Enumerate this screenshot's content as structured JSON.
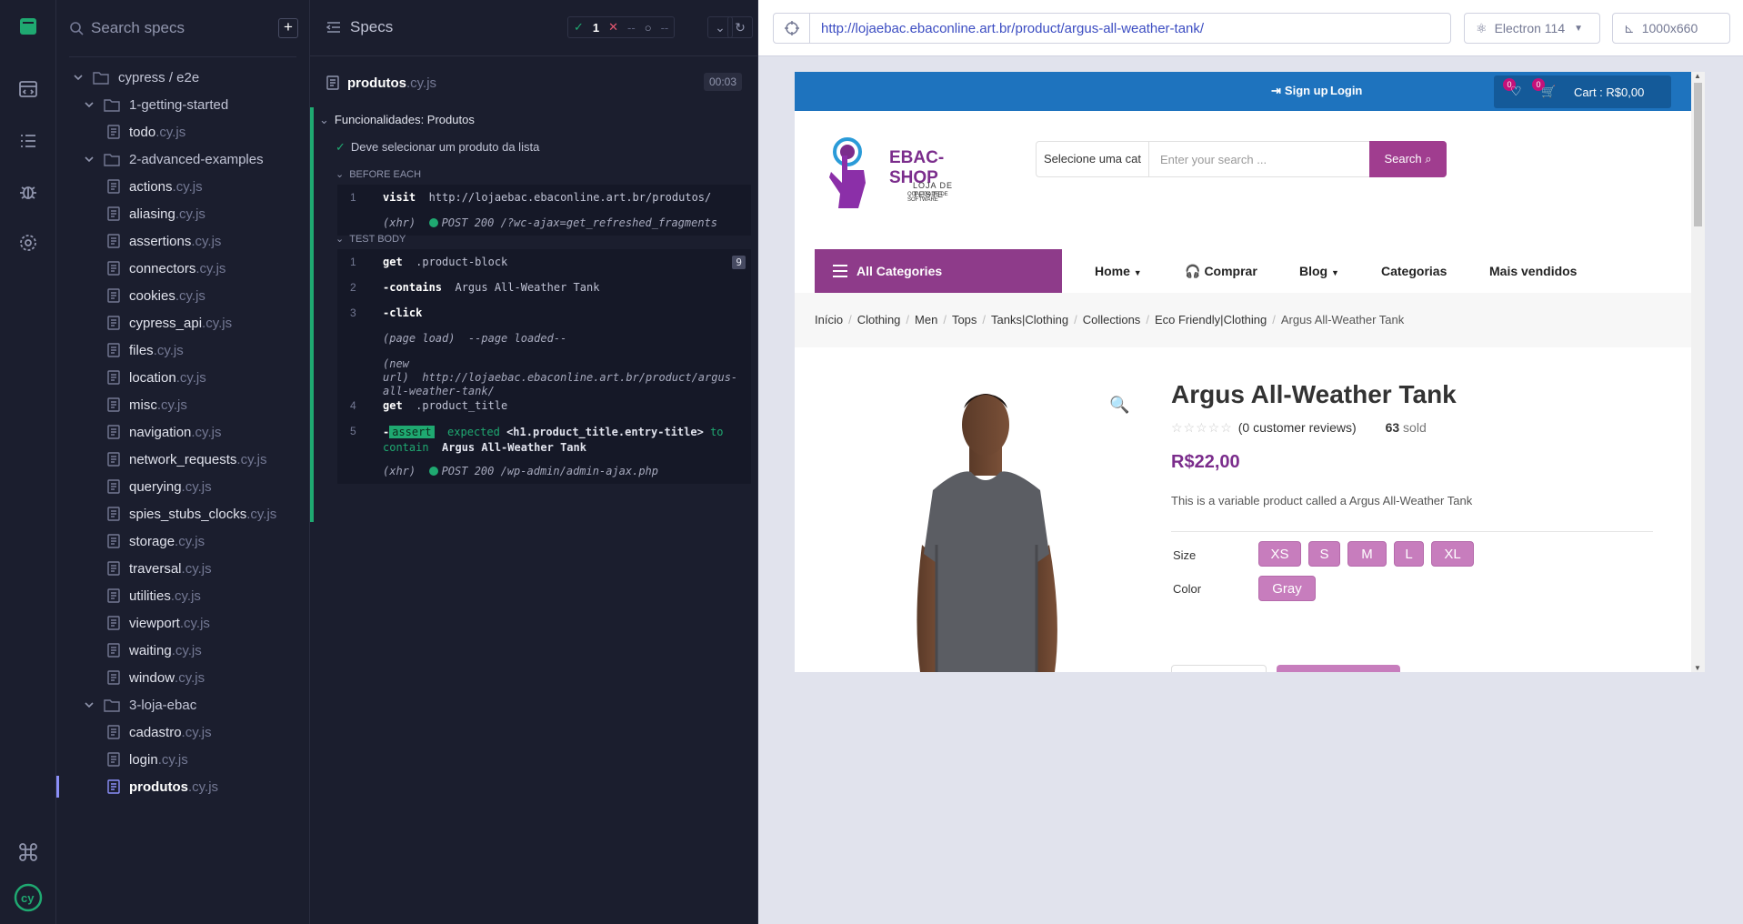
{
  "sidebar": {
    "search_placeholder": "Search specs",
    "add_label": "+",
    "tree": [
      {
        "type": "dir",
        "label": "cypress / e2e",
        "depth": 0
      },
      {
        "type": "dir",
        "label": "1-getting-started",
        "depth": 1
      },
      {
        "type": "file",
        "name": "todo",
        "ext": ".cy.js",
        "depth": 2
      },
      {
        "type": "dir",
        "label": "2-advanced-examples",
        "depth": 1
      },
      {
        "type": "file",
        "name": "actions",
        "ext": ".cy.js",
        "depth": 2
      },
      {
        "type": "file",
        "name": "aliasing",
        "ext": ".cy.js",
        "depth": 2
      },
      {
        "type": "file",
        "name": "assertions",
        "ext": ".cy.js",
        "depth": 2
      },
      {
        "type": "file",
        "name": "connectors",
        "ext": ".cy.js",
        "depth": 2
      },
      {
        "type": "file",
        "name": "cookies",
        "ext": ".cy.js",
        "depth": 2
      },
      {
        "type": "file",
        "name": "cypress_api",
        "ext": ".cy.js",
        "depth": 2
      },
      {
        "type": "file",
        "name": "files",
        "ext": ".cy.js",
        "depth": 2
      },
      {
        "type": "file",
        "name": "location",
        "ext": ".cy.js",
        "depth": 2
      },
      {
        "type": "file",
        "name": "misc",
        "ext": ".cy.js",
        "depth": 2
      },
      {
        "type": "file",
        "name": "navigation",
        "ext": ".cy.js",
        "depth": 2
      },
      {
        "type": "file",
        "name": "network_requests",
        "ext": ".cy.js",
        "depth": 2
      },
      {
        "type": "file",
        "name": "querying",
        "ext": ".cy.js",
        "depth": 2
      },
      {
        "type": "file",
        "name": "spies_stubs_clocks",
        "ext": ".cy.js",
        "depth": 2
      },
      {
        "type": "file",
        "name": "storage",
        "ext": ".cy.js",
        "depth": 2
      },
      {
        "type": "file",
        "name": "traversal",
        "ext": ".cy.js",
        "depth": 2
      },
      {
        "type": "file",
        "name": "utilities",
        "ext": ".cy.js",
        "depth": 2
      },
      {
        "type": "file",
        "name": "viewport",
        "ext": ".cy.js",
        "depth": 2
      },
      {
        "type": "file",
        "name": "waiting",
        "ext": ".cy.js",
        "depth": 2
      },
      {
        "type": "file",
        "name": "window",
        "ext": ".cy.js",
        "depth": 2
      },
      {
        "type": "dir",
        "label": "3-loja-ebac",
        "depth": 1
      },
      {
        "type": "file",
        "name": "cadastro",
        "ext": ".cy.js",
        "depth": 2
      },
      {
        "type": "file",
        "name": "login",
        "ext": ".cy.js",
        "depth": 2
      },
      {
        "type": "file",
        "name": "produtos",
        "ext": ".cy.js",
        "depth": 2,
        "active": true
      }
    ]
  },
  "reporter": {
    "title": "Specs",
    "stats": {
      "passed": "1",
      "failed": "--",
      "pending": "--"
    },
    "spec_name": "produtos",
    "spec_ext": ".cy.js",
    "duration": "00:03",
    "suite": "Funcionalidades: Produtos",
    "test": "Deve selecionar um produto da lista",
    "before_each_label": "BEFORE EACH",
    "test_body_label": "TEST BODY",
    "before": {
      "index": "1",
      "cmd": "visit",
      "arg": "http://lojaebac.ebaconline.art.br/produtos/",
      "xhr_label": "(xhr)",
      "xhr": "POST 200 /?wc-ajax=get_refreshed_fragments"
    },
    "body": {
      "c1": {
        "index": "1",
        "cmd": "get",
        "arg": ".product-block",
        "badge": "9"
      },
      "c2": {
        "index": "2",
        "cmd": "-contains",
        "arg": "Argus All-Weather Tank"
      },
      "c3": {
        "index": "3",
        "cmd": "-click"
      },
      "page_load": "(page load)",
      "page_loaded": "--page loaded--",
      "new_url_label_1": "(new",
      "new_url_label_2": "url)",
      "new_url_1": "http://lojaebac.ebaconline.art.br/product/argus-",
      "new_url_2": "all-weather-tank/",
      "c4": {
        "index": "4",
        "cmd": "get",
        "arg": ".product_title"
      },
      "c5": {
        "index": "5",
        "dash": "-",
        "assert": "assert",
        "expected": "expected",
        "el": "<h1.product_title.entry-title>",
        "to": "to",
        "contain": "contain",
        "val": "Argus All-Weather Tank"
      },
      "xhr_label": "(xhr)",
      "xhr": "POST 200 /wp-admin/admin-ajax.php"
    }
  },
  "browser": {
    "url": "http://lojaebac.ebaconline.art.br/product/argus-all-weather-tank/",
    "browser_name": "Electron 114",
    "viewport": "1000x660"
  },
  "site": {
    "signup": "Sign up",
    "login": "Login",
    "wishlist_count": "0",
    "cart_count": "0",
    "cart": "Cart : R$0,00",
    "logo_name": "EBAC-SHOP",
    "logo_sub1": "LOJA DE TESTE",
    "logo_sub2": "QUALIDADE DE SOFTWARE",
    "category_select": "Selecione uma cat",
    "search_placeholder": "Enter your search ...",
    "search_button": "Search",
    "all_categories": "All Categories",
    "menu": [
      "Home",
      "Comprar",
      "Blog",
      "Categorias",
      "Mais vendidos"
    ],
    "breadcrumbs": [
      "Início",
      "Clothing",
      "Men",
      "Tops",
      "Tanks|Clothing",
      "Collections",
      "Eco Friendly|Clothing"
    ],
    "breadcrumb_current": "Argus All-Weather Tank",
    "product": {
      "title": "Argus All-Weather Tank",
      "reviews": "(0 customer reviews)",
      "sold_count": "63",
      "sold_label": "sold",
      "price": "R$22,00",
      "description": "This is a variable product called a Argus All-Weather Tank",
      "size_label": "Size",
      "sizes": [
        "XS",
        "S",
        "M",
        "L",
        "XL"
      ],
      "color_label": "Color",
      "colors": [
        "Gray"
      ]
    }
  },
  "colors": {
    "pass": "#1fa971",
    "accent": "#8b8ff8",
    "brand": "#8e3b8a",
    "topbar": "#1e73be"
  }
}
